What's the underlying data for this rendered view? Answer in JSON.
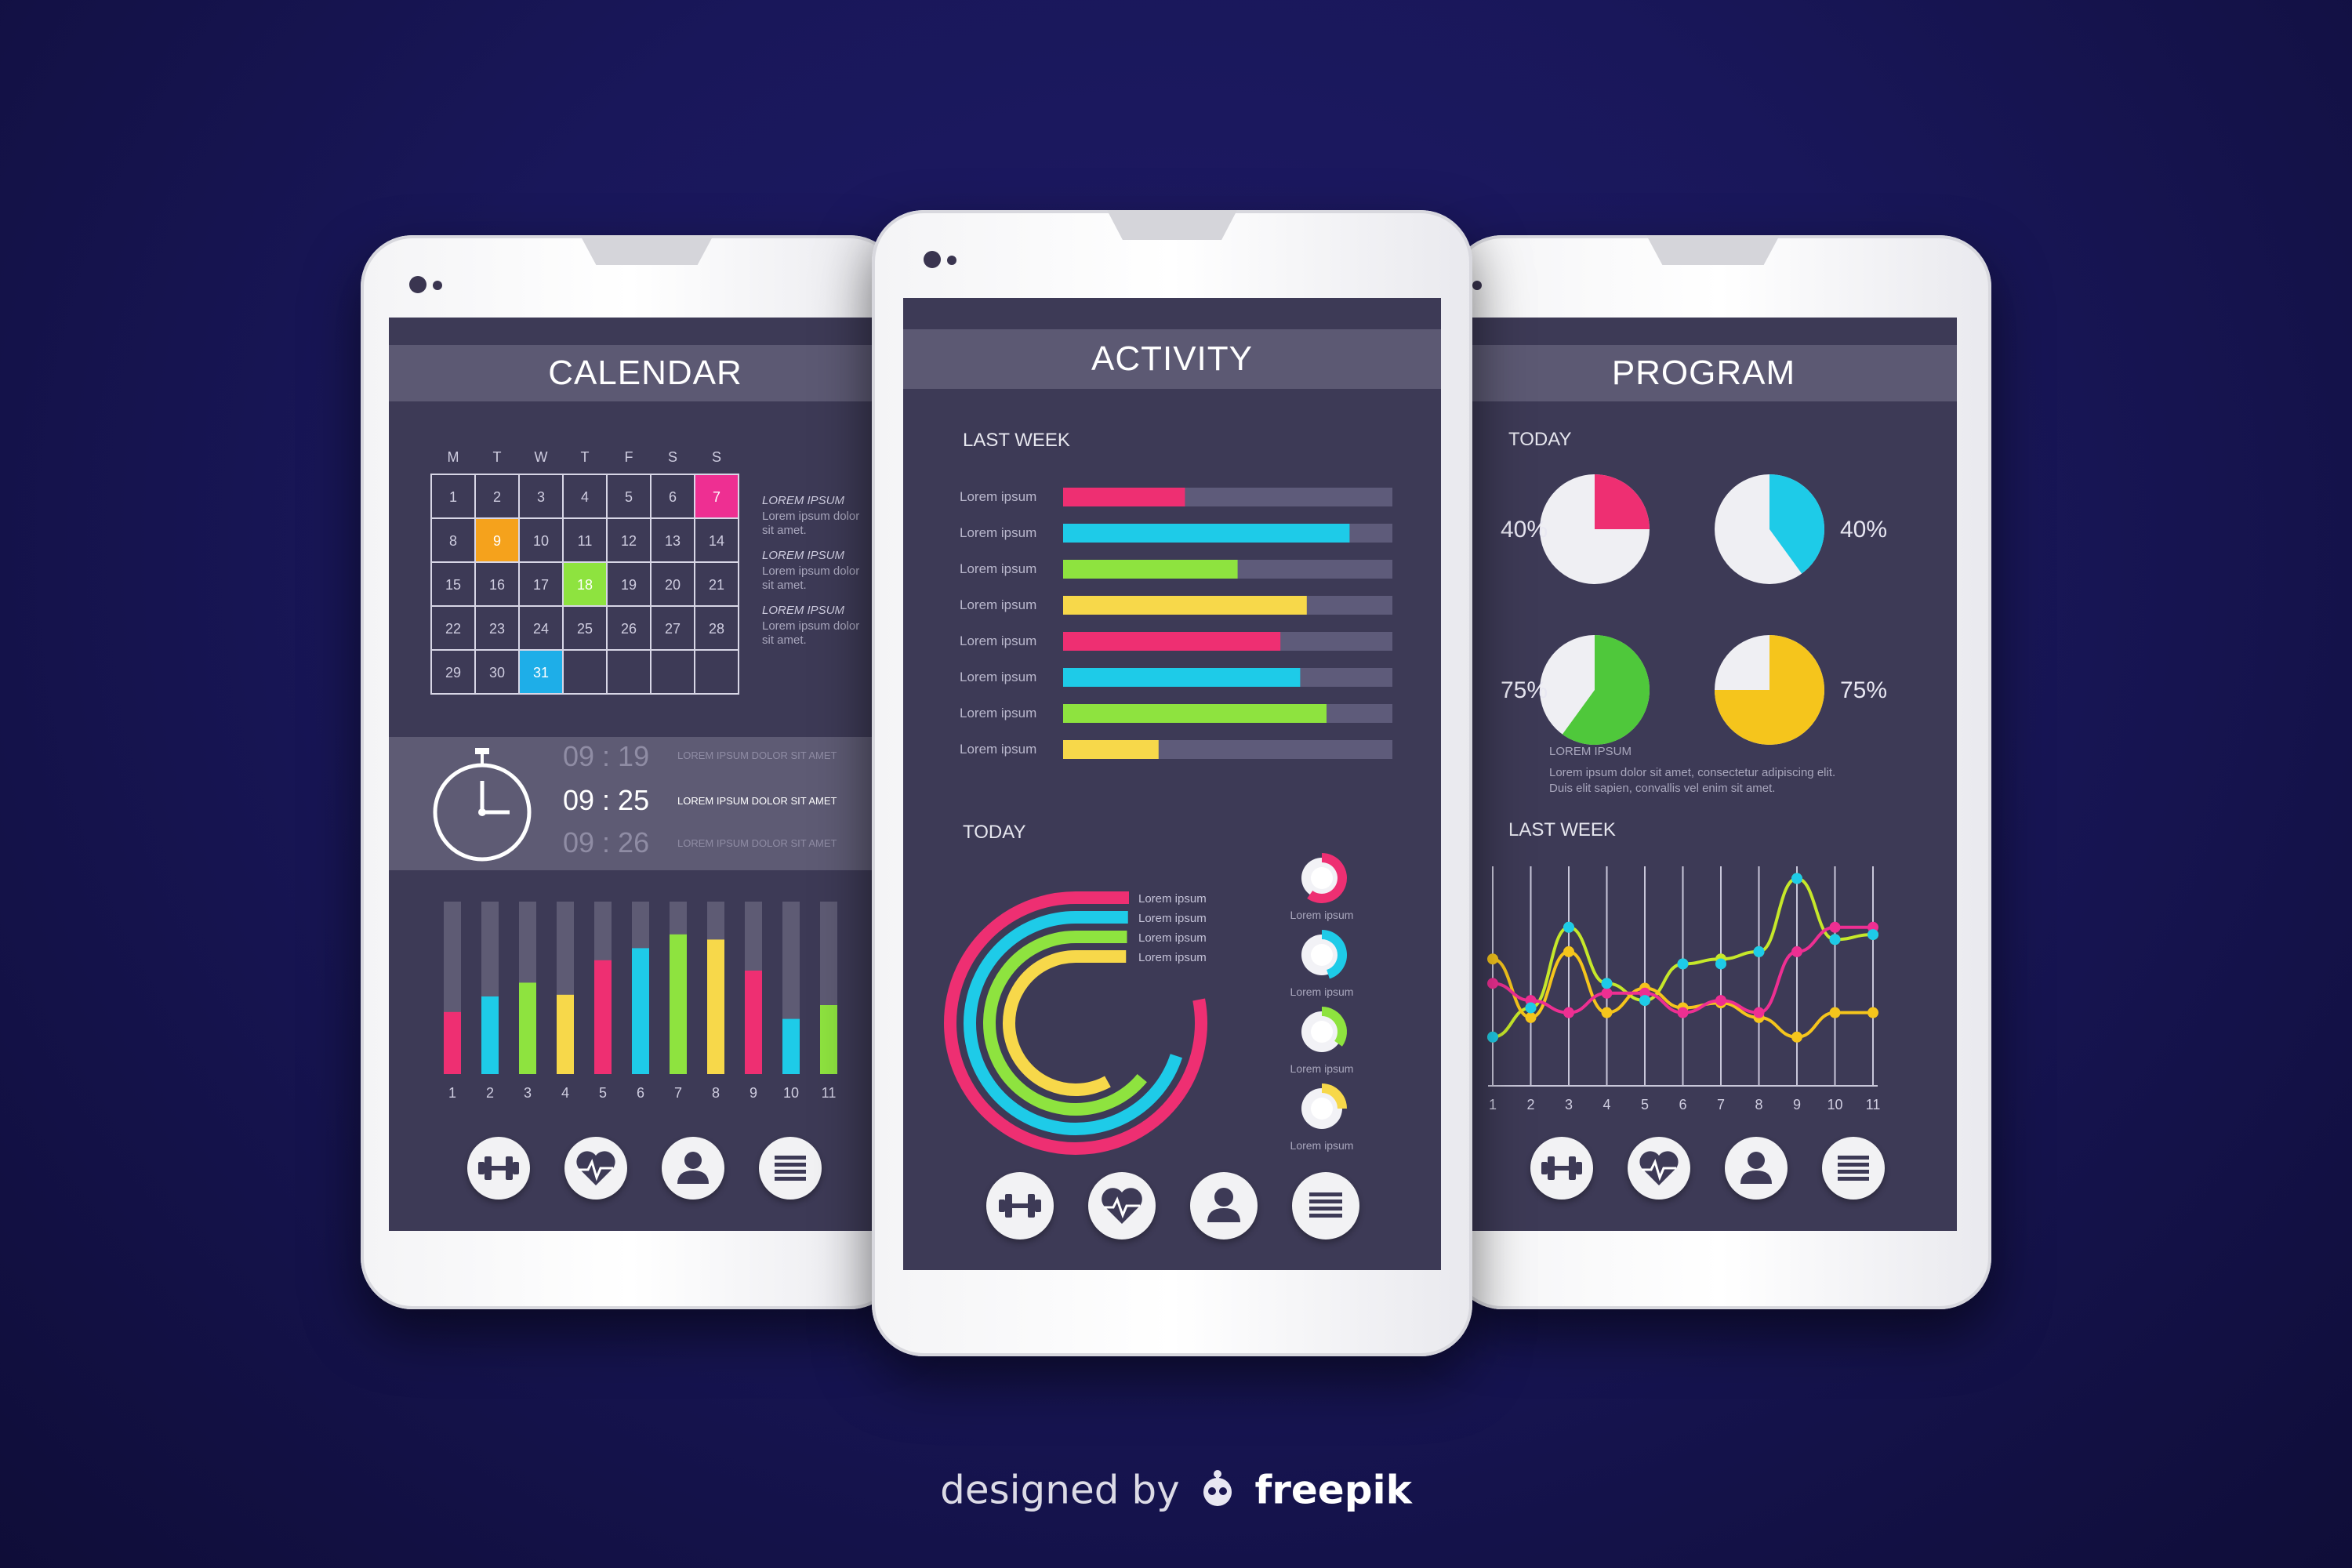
{
  "calendar": {
    "title": "CALENDAR",
    "weekdays": [
      "M",
      "T",
      "W",
      "T",
      "F",
      "S",
      "S"
    ],
    "days": [
      "1",
      "2",
      "3",
      "4",
      "5",
      "6",
      "7",
      "8",
      "9",
      "10",
      "11",
      "12",
      "13",
      "14",
      "15",
      "16",
      "17",
      "18",
      "19",
      "20",
      "21",
      "22",
      "23",
      "24",
      "25",
      "26",
      "27",
      "28",
      "29",
      "30",
      "31"
    ],
    "highlights": {
      "7": "#ee2f92",
      "9": "#f5a21c",
      "18": "#8ee33f",
      "31": "#1eaee8"
    },
    "notes": [
      {
        "title": "LOREM IPSUM",
        "body1": "Lorem ipsum dolor",
        "body2": "sit amet."
      },
      {
        "title": "LOREM IPSUM",
        "body1": "Lorem ipsum dolor",
        "body2": "sit amet."
      },
      {
        "title": "LOREM IPSUM",
        "body1": "Lorem ipsum dolor",
        "body2": "sit amet."
      }
    ],
    "timer": {
      "prev_time": "09 : 19",
      "prev_text": "LOREM IPSUM DOLOR SIT AMET",
      "time": "09 : 25",
      "text": "LOREM IPSUM DOLOR SIT AMET",
      "next_time": "09 : 26",
      "next_text": "LOREM IPSUM DOLOR SIT AMET"
    }
  },
  "activity": {
    "title": "ACTIVITY",
    "last_week_label": "LAST WEEK",
    "bar_label": "Lorem ipsum",
    "today_label": "TODAY",
    "radial_labels": [
      "Lorem ipsum",
      "Lorem ipsum",
      "Lorem ipsum",
      "Lorem ipsum"
    ],
    "ring_labels": [
      "Lorem ipsum",
      "Lorem ipsum",
      "Lorem ipsum",
      "Lorem ipsum"
    ]
  },
  "program": {
    "title": "PROGRAM",
    "today_label": "TODAY",
    "pies": [
      {
        "label": "40%",
        "value": 25,
        "color": "#ee2f72"
      },
      {
        "label": "40%",
        "value": 40,
        "color": "#1ecbe8"
      },
      {
        "label": "75%",
        "value": 60,
        "color": "#4fc83b"
      },
      {
        "label": "75%",
        "value": 75,
        "color": "#f5c51c"
      }
    ],
    "desc_title": "LOREM IPSUM",
    "desc_line1": "Lorem ipsum dolor sit amet, consectetur adipiscing elit.",
    "desc_line2": "Duis elit sapien, convallis vel enim sit amet.",
    "last_week_label": "LAST WEEK"
  },
  "nav": [
    "dumbbell-icon",
    "heart-rate-icon",
    "profile-icon",
    "menu-icon"
  ],
  "brand": {
    "prefix": "designed by",
    "name": "freepik"
  },
  "chart_data": [
    {
      "type": "bar",
      "categories": [
        "1",
        "2",
        "3",
        "4",
        "5",
        "6",
        "7",
        "8",
        "9",
        "10",
        "11"
      ],
      "values": [
        36,
        45,
        53,
        46,
        66,
        73,
        81,
        78,
        60,
        32,
        40
      ],
      "ylim": [
        0,
        100
      ],
      "colors": [
        "#ee2f72",
        "#1ecbe8",
        "#8ee33f",
        "#f7d84a",
        "#ee2f72",
        "#1ecbe8",
        "#8ee33f",
        "#f7d84a",
        "#ee2f72",
        "#1ecbe8",
        "#8ee33f"
      ]
    },
    {
      "type": "bar",
      "categories": [
        "Lorem ipsum",
        "Lorem ipsum",
        "Lorem ipsum",
        "Lorem ipsum",
        "Lorem ipsum",
        "Lorem ipsum",
        "Lorem ipsum",
        "Lorem ipsum"
      ],
      "values": [
        37,
        87,
        53,
        74,
        66,
        72,
        80,
        29
      ],
      "xlim": [
        0,
        100
      ],
      "colors": [
        "#ee2f72",
        "#1ecbe8",
        "#8ee33f",
        "#f7d84a",
        "#ee2f72",
        "#1ecbe8",
        "#8ee33f",
        "#f7d84a"
      ]
    },
    {
      "type": "pie",
      "values": [
        78,
        70,
        64,
        58
      ],
      "colors": [
        "#ee2f72",
        "#1ecbe8",
        "#8ee33f",
        "#f7d84a"
      ]
    },
    {
      "type": "pie",
      "values": [
        60,
        45,
        35,
        25
      ],
      "colors": [
        "#ee2f72",
        "#1ecbe8",
        "#8ee33f",
        "#f7d84a"
      ]
    },
    {
      "type": "line",
      "x": [
        1,
        2,
        3,
        4,
        5,
        6,
        7,
        8,
        9,
        10,
        11
      ],
      "series": [
        {
          "values": [
            2.0,
            3.2,
            6.5,
            4.2,
            3.5,
            5.0,
            5.2,
            5.5,
            8.5,
            6.0,
            6.2
          ],
          "color": "#c6e82a"
        },
        {
          "values": [
            5.2,
            2.8,
            5.5,
            3.0,
            4.0,
            3.2,
            3.4,
            2.8,
            2.0,
            3.0,
            3.0
          ],
          "color": "#f5c51c"
        },
        {
          "values": [
            4.2,
            3.5,
            3.0,
            3.8,
            3.8,
            3.0,
            3.5,
            3.0,
            5.5,
            6.5,
            6.5
          ],
          "color": "#ee2f92"
        },
        {
          "values": [
            2.0,
            3.2,
            6.5,
            4.2,
            3.5,
            5.0,
            5.0,
            5.5,
            8.5,
            6.0,
            6.2
          ],
          "color": "#1ecbe8"
        }
      ],
      "ylim": [
        0,
        9
      ]
    }
  ]
}
